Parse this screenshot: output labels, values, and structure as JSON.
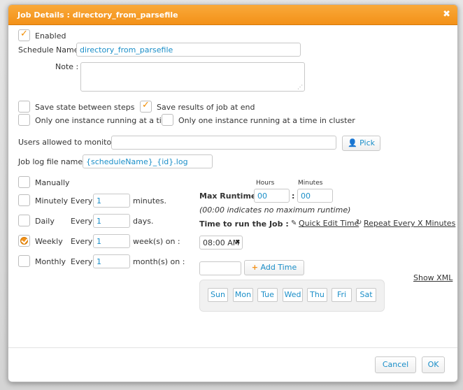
{
  "dialog": {
    "title": "Job Details : directory_from_parsefile",
    "close_icon": "✖"
  },
  "enabled": {
    "label": "Enabled",
    "checked": true
  },
  "schedule_name": {
    "label": "Schedule Name :",
    "value": "directory_from_parsefile"
  },
  "note": {
    "label": "Note :",
    "value": ""
  },
  "options": {
    "save_state": {
      "label": "Save state between steps",
      "checked": false
    },
    "save_results": {
      "label": "Save results of job at end",
      "checked": true
    },
    "one_instance": {
      "label": "Only one instance running at a time",
      "checked": false
    },
    "one_instance_cluster": {
      "label": "Only one instance running at a time in cluster",
      "checked": false
    }
  },
  "monitor": {
    "label": "Users allowed to monitor :",
    "value": "",
    "pick_label": "Pick"
  },
  "job_log": {
    "label": "Job log file name :",
    "value": "{scheduleName}_{id}.log"
  },
  "schedule": {
    "manually": "Manually",
    "minutely": {
      "label": "Minutely",
      "every": "Every",
      "value": "1",
      "unit": "minutes."
    },
    "daily": {
      "label": "Daily",
      "every": "Every",
      "value": "1",
      "unit": "days."
    },
    "weekly": {
      "label": "Weekly",
      "every": "Every",
      "value": "1",
      "unit": "week(s) on :"
    },
    "monthly": {
      "label": "Monthly",
      "every": "Every",
      "value": "1",
      "unit": "month(s) on :"
    },
    "selected": "weekly"
  },
  "runtime": {
    "hours_label": "Hours",
    "minutes_label": "Minutes",
    "label": "Max Runtime :",
    "hours": "00",
    "separator": ":",
    "minutes": "00",
    "note": "(00:00 indicates no maximum runtime)"
  },
  "time_to_run": {
    "label": "Time to run the Job :",
    "quick_edit": "Quick Edit Time",
    "repeat": "Repeat Every X Minutes",
    "time_value": "08:00 AM",
    "remove_icon": "✖",
    "add_time_label": "Add Time",
    "add_time_value": ""
  },
  "days": [
    "Sun",
    "Mon",
    "Tue",
    "Wed",
    "Thu",
    "Fri",
    "Sat"
  ],
  "show_xml": "Show XML",
  "footer": {
    "cancel": "Cancel",
    "ok": "OK"
  },
  "colors": {
    "accent": "#f39118",
    "link": "#1a8ec8"
  }
}
